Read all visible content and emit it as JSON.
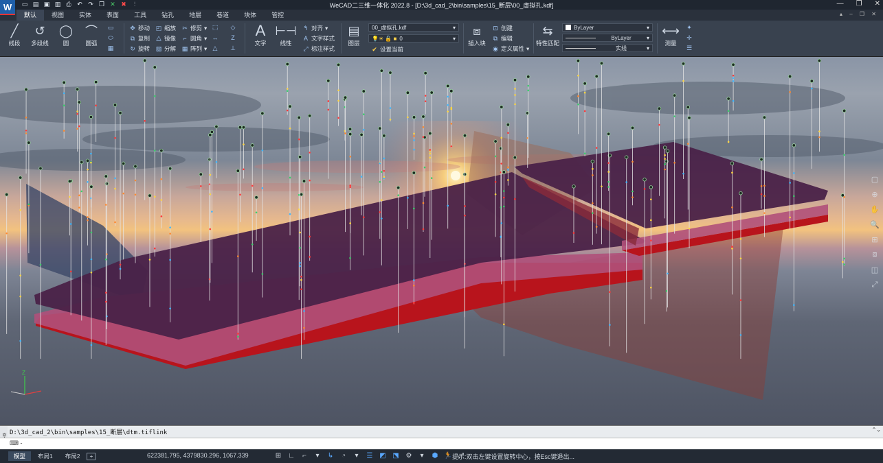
{
  "app": {
    "window_title": "WeCAD二三维一体化 2022.8 - [D:\\3d_cad_2\\bin\\samples\\15_断层\\00_虚拟孔.kdf]",
    "logo_text": "W"
  },
  "menu": {
    "tabs": [
      "默认",
      "视图",
      "实体",
      "表面",
      "工具",
      "钻孔",
      "地层",
      "巷道",
      "块体",
      "管控"
    ],
    "active": "默认"
  },
  "ribbon": {
    "draw": {
      "line": "线段",
      "polyline": "多段线",
      "circle": "圆",
      "arc": "圆弧"
    },
    "modify": {
      "move": "移动",
      "copy": "复制",
      "rotate": "旋转",
      "scale": "缩放",
      "mirror": "镜像",
      "explode": "分解",
      "trim": "修剪",
      "fillet": "圆角",
      "array": "阵列"
    },
    "annotate": {
      "text": "文字",
      "linear": "线性",
      "align": "对齐",
      "text_style": "文字样式",
      "dim_style": "标注样式"
    },
    "layer": {
      "layers": "图层",
      "current_file": "00_虚拟孔.kdf",
      "current_layer": "0",
      "set_current": "设置当前"
    },
    "block": {
      "insert": "插入块",
      "create": "创建",
      "edit": "编辑",
      "define_attr": "定义属性"
    },
    "properties": {
      "match": "特性匹配",
      "color": "ByLayer",
      "linetype": "ByLayer",
      "lineweight": "实线"
    },
    "utilities": {
      "measure": "测量"
    }
  },
  "command": {
    "history": "D:\\3d_cad_2\\bin\\samples\\15_断层\\dtm.tiflink",
    "prompt": "⌨ -",
    "input_value": "",
    "side_label": "命令行"
  },
  "status": {
    "layouts": [
      "模型",
      "布局1",
      "布局2"
    ],
    "active_layout": "模型",
    "add_layout": "+",
    "coordinates": "622381.795, 4379830.296, 1067.339",
    "hint": "提示:双击左键设置旋转中心，按Esc键退出..."
  },
  "colors": {
    "surface_top": "#4a2248",
    "surface_mid": "#8a3e6a",
    "surface_bottom": "#b8141c",
    "fault_plane": "#8c3c36",
    "borehole_line": "#e8e8e8",
    "ui_dark": "#2b3340",
    "accent": "#5aa9ff"
  }
}
